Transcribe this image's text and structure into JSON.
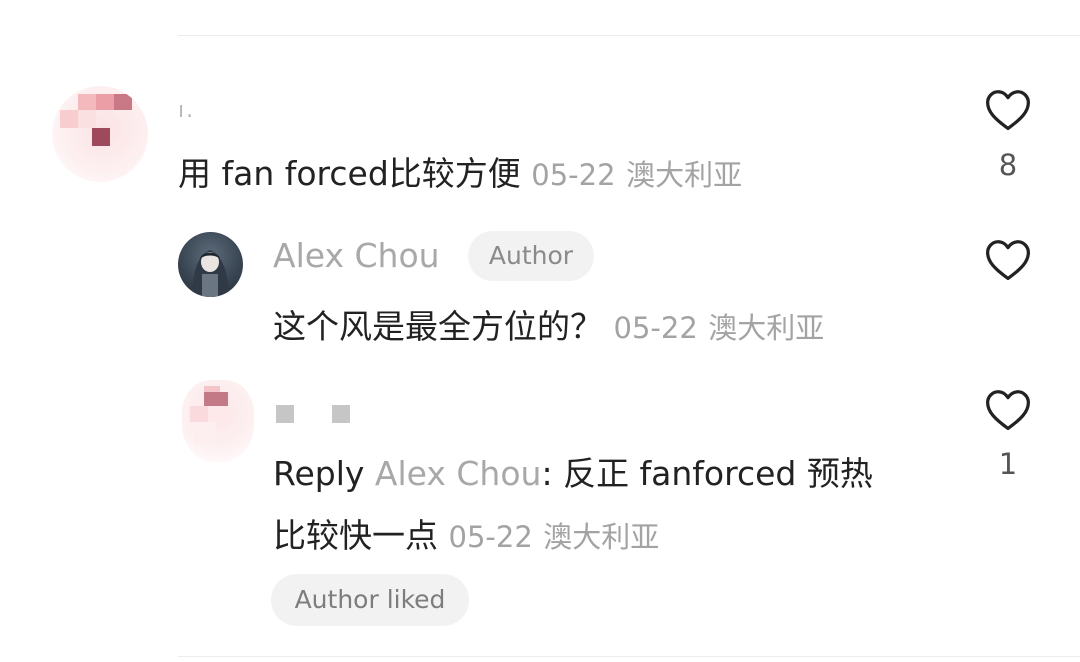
{
  "comments": [
    {
      "username": "ı.",
      "text": "用 fan forced比较方便",
      "date": "05-22",
      "location": "澳大利亚",
      "likes": "8",
      "icon": "heart-outline-icon"
    },
    {
      "username": "Alex Chou",
      "badge": "Author",
      "text": "这个风是最全方位的？",
      "date": "05-22",
      "location": "澳大利亚",
      "likes": "",
      "icon": "heart-outline-icon"
    },
    {
      "reply_prefix": "Reply",
      "reply_target": "Alex Chou",
      "reply_separator": ": ",
      "text_line1": "反正 fanforced 预热",
      "text_line2": "比较快一点",
      "date": "05-22",
      "location": "澳大利亚",
      "likes": "1",
      "author_liked": "Author liked",
      "icon": "heart-outline-icon"
    }
  ],
  "colors": {
    "primary_text": "#222222",
    "secondary_text": "#a3a3a3",
    "badge_background": "#f2f2f2",
    "heart_stroke": "#222222"
  }
}
